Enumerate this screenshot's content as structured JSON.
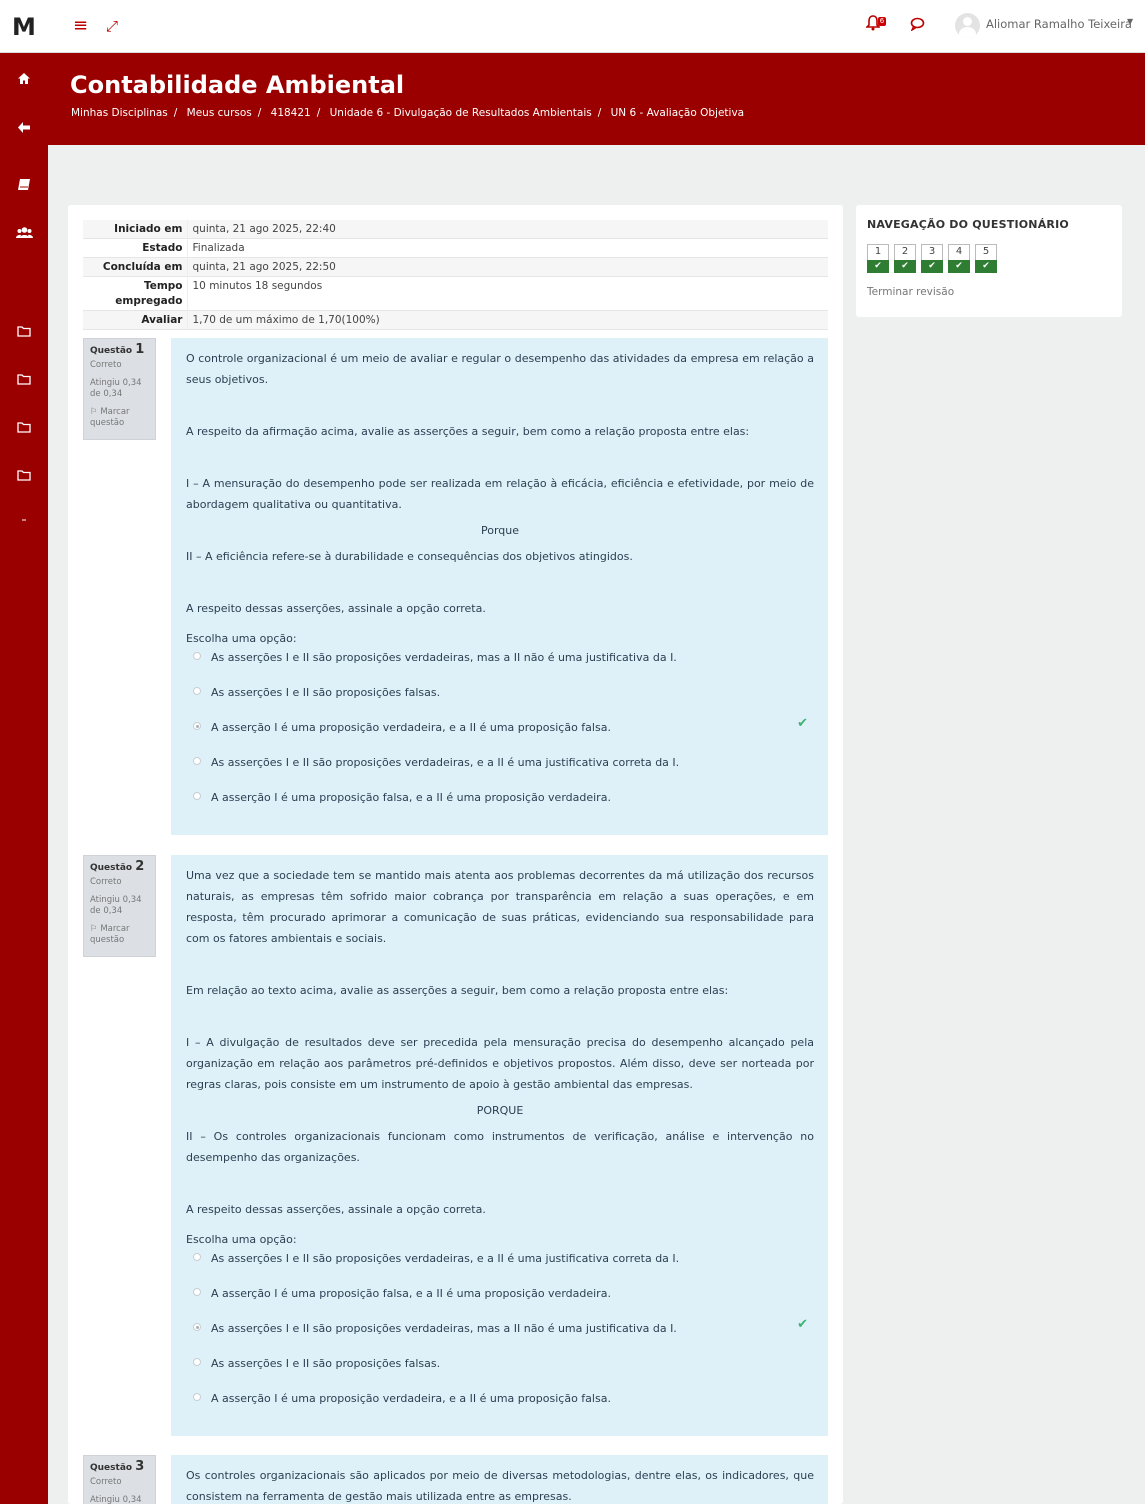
{
  "topbar": {
    "logo": "M",
    "user_name": "Aliomar Ramalho Teixeira",
    "notification_count": "6"
  },
  "header": {
    "course_title": "Contabilidade Ambiental",
    "breadcrumb": [
      "Minhas Disciplinas",
      "Meus cursos",
      "418421",
      "Unidade 6 - Divulgação de Resultados Ambientais",
      "UN 6 - Avaliação Objetiva"
    ]
  },
  "summary": [
    {
      "label": "Iniciado em",
      "value": "quinta, 21 ago 2025, 22:40"
    },
    {
      "label": "Estado",
      "value": "Finalizada"
    },
    {
      "label": "Concluída em",
      "value": "quinta, 21 ago 2025, 22:50"
    },
    {
      "label": "Tempo empregado",
      "value": "10 minutos 18 segundos"
    },
    {
      "label": "Avaliar",
      "value": "1,70 de um máximo de 1,70(100%)"
    }
  ],
  "questions": [
    {
      "label": "Questão",
      "number": "1",
      "state": "Correto",
      "grade": "Atingiu 0,34 de 0,34",
      "flag": "Marcar questão",
      "para_intro": "O controle organizacional é um meio de avaliar e regular o desempenho das atividades da empresa em relação a seus objetivos.",
      "para_ask": "A respeito da afirmação acima, avalie as asserções a seguir, bem como a relação proposta entre elas:",
      "para_i": "I – A mensuração do desempenho pode ser realizada em relação à eficácia, eficiência e efetividade, por meio de abordagem qualitativa ou quantitativa.",
      "connector": "Porque",
      "para_ii": "II – A eficiência refere-se à durabilidade e consequências dos objetivos atingidos.",
      "para_final": "A respeito dessas asserções, assinale a opção correta.",
      "choose": "Escolha uma opção:",
      "answers": [
        "As asserções I e II são proposições verdadeiras, mas a II não é uma justificativa da I.",
        "As asserções I e II são proposições falsas.",
        "A asserção I é uma proposição verdadeira, e a II é uma proposição falsa.",
        "As asserções I e II são proposições verdadeiras, e a II é uma justificativa correta da I.",
        "A asserção I é uma proposição falsa, e a II é uma proposição verdadeira."
      ]
    },
    {
      "label": "Questão",
      "number": "2",
      "state": "Correto",
      "grade": "Atingiu 0,34 de 0,34",
      "flag": "Marcar questão",
      "para_intro": "Uma vez que a sociedade tem se mantido mais atenta aos problemas decorrentes da má utilização dos recursos naturais, as empresas têm sofrido maior cobrança por transparência em relação a suas operações, e em resposta, têm procurado aprimorar a comunicação de suas práticas, evidenciando sua responsabilidade para com os fatores ambientais e sociais.",
      "para_ask": "Em relação ao texto acima, avalie as asserções a seguir, bem como a relação proposta entre elas:",
      "para_i": "I – A divulgação de resultados deve ser precedida pela mensuração precisa do desempenho alcançado pela organização em relação aos parâmetros pré-definidos e objetivos propostos. Além disso, deve ser norteada por regras claras, pois consiste em um instrumento de apoio à gestão ambiental das empresas.",
      "connector": "PORQUE",
      "para_ii": "II – Os controles organizacionais funcionam como instrumentos de verificação, análise e intervenção no desempenho das organizações.",
      "para_final": "A respeito dessas asserções, assinale a opção correta.",
      "choose": "Escolha uma opção:",
      "answers": [
        "As asserções I e II são proposições verdadeiras, e a II é uma justificativa correta da I.",
        "A asserção I é uma proposição falsa, e a II é uma proposição verdadeira.",
        "As asserções I e II são proposições verdadeiras, mas a II não é uma justificativa da I.",
        "As asserções I e II são proposições falsas.",
        "A asserção I é uma proposição verdadeira, e a II é uma proposição falsa."
      ]
    },
    {
      "label": "Questão",
      "number": "3",
      "state": "Correto",
      "grade": "Atingiu 0,34",
      "para_intro": "Os controles organizacionais são aplicados por meio de diversas metodologias, dentre elas, os indicadores, que consistem na ferramenta de gestão mais utilizada entre as empresas."
    }
  ],
  "quiz_nav": {
    "title": "NAVEGAÇÃO DO QUESTIONÁRIO",
    "buttons": [
      "1",
      "2",
      "3",
      "4",
      "5"
    ],
    "finish_label": "Terminar revisão"
  }
}
